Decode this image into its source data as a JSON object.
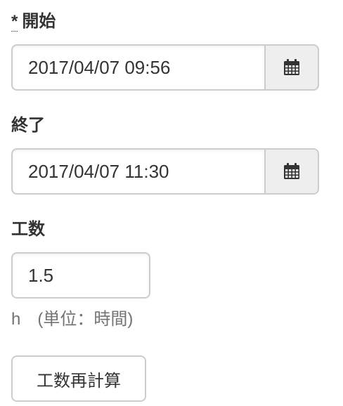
{
  "start": {
    "required_mark": "*",
    "label": "開始",
    "value": "2017/04/07 09:56",
    "icon": "calendar-icon"
  },
  "end": {
    "label": "終了",
    "value": "2017/04/07 11:30",
    "icon": "calendar-icon"
  },
  "effort": {
    "label": "工数",
    "value": "1.5",
    "help": "h　(単位：時間)"
  },
  "recalc_button": {
    "label": "工数再計算"
  }
}
